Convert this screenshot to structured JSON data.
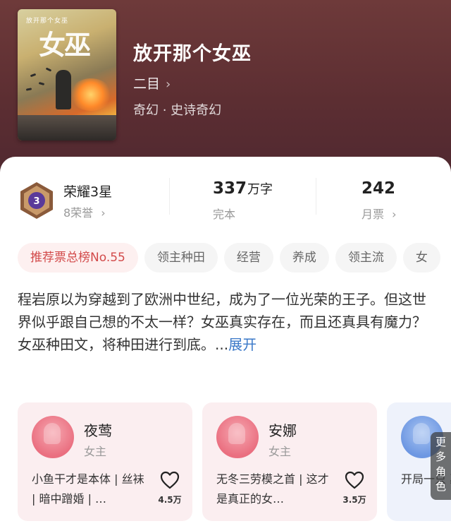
{
  "cover": {
    "series_text": "放开那个女巫",
    "title_text": "女巫"
  },
  "book": {
    "title": "放开那个女巫",
    "author": "二目",
    "genre": "奇幻 · 史诗奇幻"
  },
  "stats": {
    "honor_level": "荣耀3星",
    "honor_level_number": "3",
    "honor_count": "8荣誉",
    "word_count": "337",
    "word_unit": "万字",
    "status": "完本",
    "monthly_votes": "242",
    "monthly_votes_label": "月票"
  },
  "tags": [
    "推荐票总榜No.55",
    "领主种田",
    "经营",
    "养成",
    "领主流",
    "女"
  ],
  "synopsis": {
    "text": "程岩原以为穿越到了欧洲中世纪，成为了一位光荣的王子。但这世界似乎跟自己想的不太一样？女巫真实存在，而且还真具有魔力？\n女巫种田文，将种田进行到底。...",
    "expand": "展开"
  },
  "characters": [
    {
      "name": "夜莺",
      "role": "女主",
      "desc": "小鱼干才是本体 | 丝袜 | 暗中蹭婚 | …",
      "likes": "4.5万"
    },
    {
      "name": "安娜",
      "role": "女主",
      "desc": "无冬三劳模之首 | 这才是真正的女…",
      "likes": "3.5万"
    },
    {
      "name": "",
      "role": "",
      "desc": "开局一只 巫控 | 腿…",
      "likes": ""
    }
  ],
  "more_roles": "更多角色",
  "colors": {
    "hero_bg": "#5c2e32",
    "accent": "#d24a4a",
    "link": "#3a78c8"
  }
}
